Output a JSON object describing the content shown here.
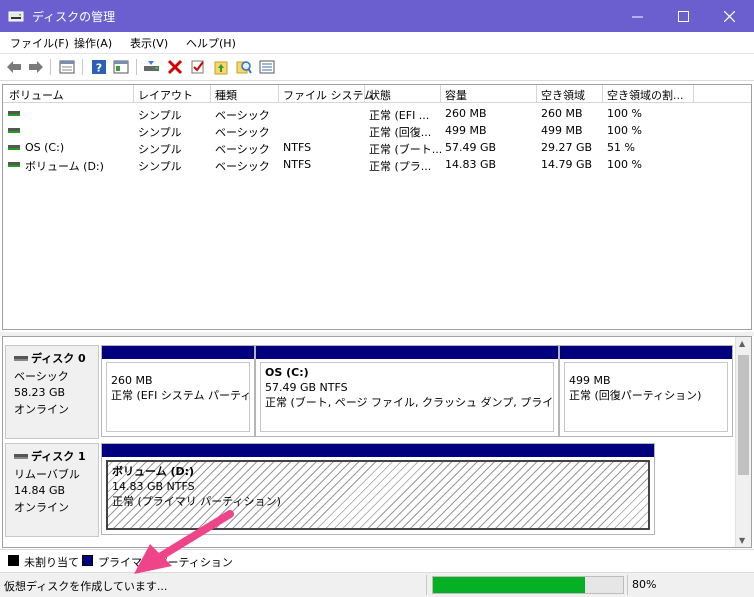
{
  "window": {
    "title": "ディスクの管理",
    "title_bar_color": "#6b5fd0"
  },
  "menu": [
    "ファイル(F)",
    "操作(A)",
    "表示(V)",
    "ヘルプ(H)"
  ],
  "toolbar_icons": [
    "back-arrow-icon",
    "forward-arrow-icon",
    "properties-icon",
    "help-icon",
    "console-tree-icon",
    "connect-disk-icon",
    "delete-icon",
    "check-icon",
    "up-folder-icon",
    "search-icon",
    "list-view-icon"
  ],
  "volume_table": {
    "columns": [
      "ボリューム",
      "レイアウト",
      "種類",
      "ファイル システム",
      "状態",
      "容量",
      "空き領域",
      "空き領域の割..."
    ],
    "rows": [
      [
        "",
        "シンプル",
        "ベーシック",
        "",
        "正常 (EFI ...",
        "260 MB",
        "260 MB",
        "100 %"
      ],
      [
        "",
        "シンプル",
        "ベーシック",
        "",
        "正常 (回復...",
        "499 MB",
        "499 MB",
        "100 %"
      ],
      [
        "OS (C:)",
        "シンプル",
        "ベーシック",
        "NTFS",
        "正常 (ブート...",
        "57.49 GB",
        "29.27 GB",
        "51 %"
      ],
      [
        "ボリューム (D:)",
        "シンプル",
        "ベーシック",
        "NTFS",
        "正常 (プラ...",
        "14.83 GB",
        "14.79 GB",
        "100 %"
      ]
    ]
  },
  "disks": [
    {
      "name": "ディスク 0",
      "type": "ベーシック",
      "size": "58.23 GB",
      "status": "オンライン",
      "partitions": [
        {
          "name": "",
          "size": "260 MB",
          "status": "正常 (EFI システム パーティション)"
        },
        {
          "name": "OS  (C:)",
          "size": "57.49 GB NTFS",
          "status": "正常 (ブート, ページ ファイル, クラッシュ ダンプ, プライマリ パーティション)"
        },
        {
          "name": "",
          "size": "499 MB",
          "status": "正常 (回復パーティション)"
        }
      ]
    },
    {
      "name": "ディスク 1",
      "type": "リムーバブル",
      "size": "14.84 GB",
      "status": "オンライン",
      "partitions": [
        {
          "name": "ボリューム  (D:)",
          "size": "14.83 GB NTFS",
          "status": "正常 (プライマリ パーティション)"
        }
      ]
    }
  ],
  "legend": [
    {
      "label": "未割り当て",
      "color": "#000000"
    },
    {
      "label": "プライマリ パーティション",
      "color": "#00007f"
    }
  ],
  "status": {
    "text": "仮想ディスクを作成しています...",
    "progress": 0.8,
    "progress_label": "80%",
    "progress_color": "#06b025"
  },
  "annotation_arrow_color": "#f0448a"
}
